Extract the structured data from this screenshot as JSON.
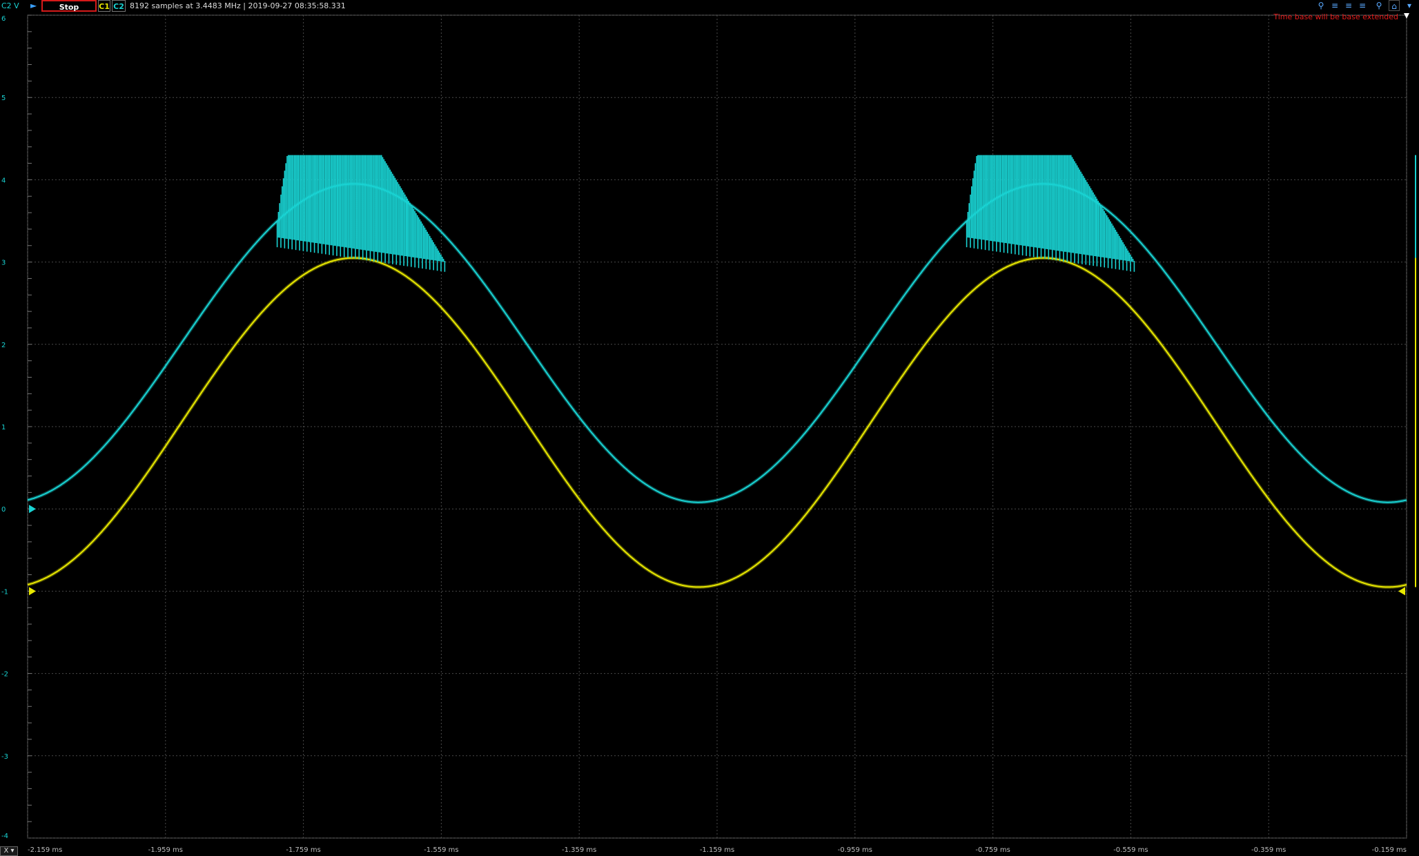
{
  "toolbar": {
    "channel_scale": "C2 V",
    "run_icon": "play-icon",
    "stop_label": "Stop",
    "c1_label": "C1",
    "c2_label": "C2",
    "acq_info": "8192 samples at 3.4483 MHz | 2019-09-27 08:35:58.331",
    "tools": [
      "zoom-in-icon",
      "zoom-horizontal-icon",
      "zoom-vertical-icon",
      "zoom-rect-icon",
      "zoom-out-icon",
      "home-icon",
      "menu-icon"
    ]
  },
  "warning": "Time base will be base extended",
  "x_mode": "X",
  "colors": {
    "c1": "#e8e800",
    "c2": "#19d3d3",
    "grid": "#4a4a4a",
    "background": "#000000",
    "stop_border": "#d61a1a",
    "warning": "#e21b1b"
  },
  "chart_data": {
    "type": "line",
    "x_ticks": [
      "-2.159 ms",
      "-1.959 ms",
      "-1.759 ms",
      "-1.559 ms",
      "-1.359 ms",
      "-1.159 ms",
      "-0.959 ms",
      "-0.759 ms",
      "-0.559 ms",
      "-0.359 ms",
      "-0.159 ms"
    ],
    "xlim": [
      -2.159,
      -0.159
    ],
    "y_ticks": [
      "6",
      "5",
      "4",
      "3",
      "2",
      "1",
      "0",
      "-1",
      "-2",
      "-3",
      "-4"
    ],
    "ylim": [
      -4,
      6
    ],
    "grid": true,
    "series": [
      {
        "name": "C1",
        "shape": "sine",
        "min": -0.95,
        "max": 3.05,
        "period_ms": 1.0,
        "peak_at_ms": -1.686
      },
      {
        "name": "C2",
        "shape": "sine-with-burst",
        "min": 0.08,
        "max": 3.95,
        "period_ms": 1.0,
        "peak_at_ms": -1.686,
        "burst": {
          "top": 4.3,
          "bottom_start": 3.3,
          "bottom_end": 3.0,
          "segments_ms": [
            [
              -1.797,
              -1.553
            ],
            [
              -0.797,
              -0.553
            ]
          ]
        }
      }
    ]
  }
}
